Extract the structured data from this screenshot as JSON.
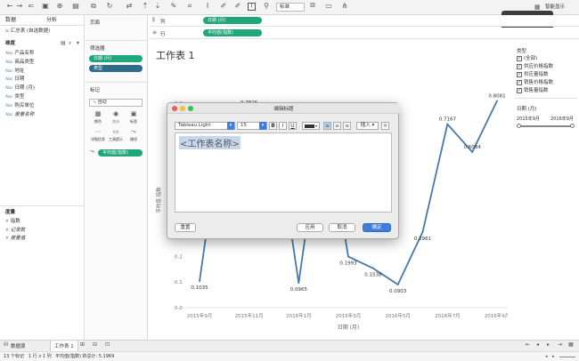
{
  "toolbar": {
    "font_select": "标准",
    "smart_display": "智能显示",
    "abc_label": "Abc"
  },
  "left_panel": {
    "tabs": [
      "数据",
      "分析"
    ],
    "datasource": "汇总表 (自选数据)",
    "dimensions_label": "维度",
    "dimensions": [
      {
        "type": "Abc",
        "name": "产品名称"
      },
      {
        "type": "Abc",
        "name": "商品类型"
      },
      {
        "type": "Abc",
        "name": "地址"
      },
      {
        "type": "Abc",
        "name": "日期"
      },
      {
        "type": "Abc",
        "name": "日期 (月)"
      },
      {
        "type": "Abc",
        "name": "类型"
      },
      {
        "type": "Abc",
        "name": "购买单位"
      },
      {
        "type": "Abc",
        "name": "度量名称"
      }
    ],
    "measures_label": "度量",
    "measures": [
      "指数",
      "记录数",
      "度量值"
    ]
  },
  "mid_panel": {
    "pages_label": "页面",
    "filters_label": "筛选器",
    "filters": [
      "日期 (月)",
      "类型"
    ],
    "marks_label": "标记",
    "marks_type": "自动",
    "marks_buttons": [
      "颜色",
      "大小",
      "标签",
      "详细信息",
      "工具提示",
      "路径"
    ],
    "marks_pill": "平均值(指数)"
  },
  "shelves": {
    "columns_label": "列",
    "columns_pill": "日期 (月)",
    "rows_label": "行",
    "rows_pill": "平均值(指数)"
  },
  "worksheet_title": "工作表 1",
  "chart_data": {
    "type": "line",
    "x": [
      "2015年9月",
      "2015年10月",
      "2015年11月",
      "2015年12月",
      "2016年1月",
      "2016年2月",
      "2016年3月",
      "2016年4月",
      "2016年5月",
      "2016年6月",
      "2016年7月",
      "2016年8月",
      "2016年9月"
    ],
    "xticks": [
      "2015年9月",
      "2015年11月",
      "2016年1月",
      "2016年3月",
      "2016年5月",
      "2016年7月",
      "2016年9月"
    ],
    "values": [
      0.1035,
      0.78,
      0.7826,
      0.75,
      0.0965,
      0.78,
      0.1993,
      0.1538,
      0.0903,
      0.2961,
      0.7167,
      0.6084,
      0.8081
    ],
    "labels": [
      "0.1035",
      "",
      "0.7826",
      "",
      "0.0965",
      "",
      "0.1993",
      "0.1538",
      "0.0903",
      "0.2961",
      "0.7167",
      "0.6084",
      "0.8081"
    ],
    "yticks": [
      "0.0",
      "0.1",
      "0.2",
      "0.8"
    ],
    "ylim": [
      0,
      0.9
    ],
    "xlabel": "日期 (月)",
    "ylabel": "平均值 指数"
  },
  "right_panel": {
    "type_label": "类型",
    "types": [
      {
        "label": "(全部)",
        "checked": true
      },
      {
        "label": "供应价格指数",
        "checked": true
      },
      {
        "label": "供应量指数",
        "checked": true
      },
      {
        "label": "销售价格指数",
        "checked": true
      },
      {
        "label": "销售量指数",
        "checked": true
      }
    ],
    "date_label": "日期 (月)",
    "date_from": "2015年9月",
    "date_to": "2016年9月"
  },
  "dialog": {
    "title": "编辑标题",
    "font": "Tableau Light",
    "size": "15",
    "bold": "B",
    "italic": "I",
    "underline": "U",
    "insert": "插入",
    "content": "<工作表名称>",
    "reset": "重置",
    "apply": "应用",
    "cancel": "取消",
    "ok": "确定"
  },
  "statusbar": {
    "datasource_tab": "数据源",
    "sheet_tab": "工作表 1",
    "marks": "13 个标记",
    "rows_cols": "1 行 x 1 列",
    "sum": "平均值(指数) 的总计: 5.1969"
  }
}
